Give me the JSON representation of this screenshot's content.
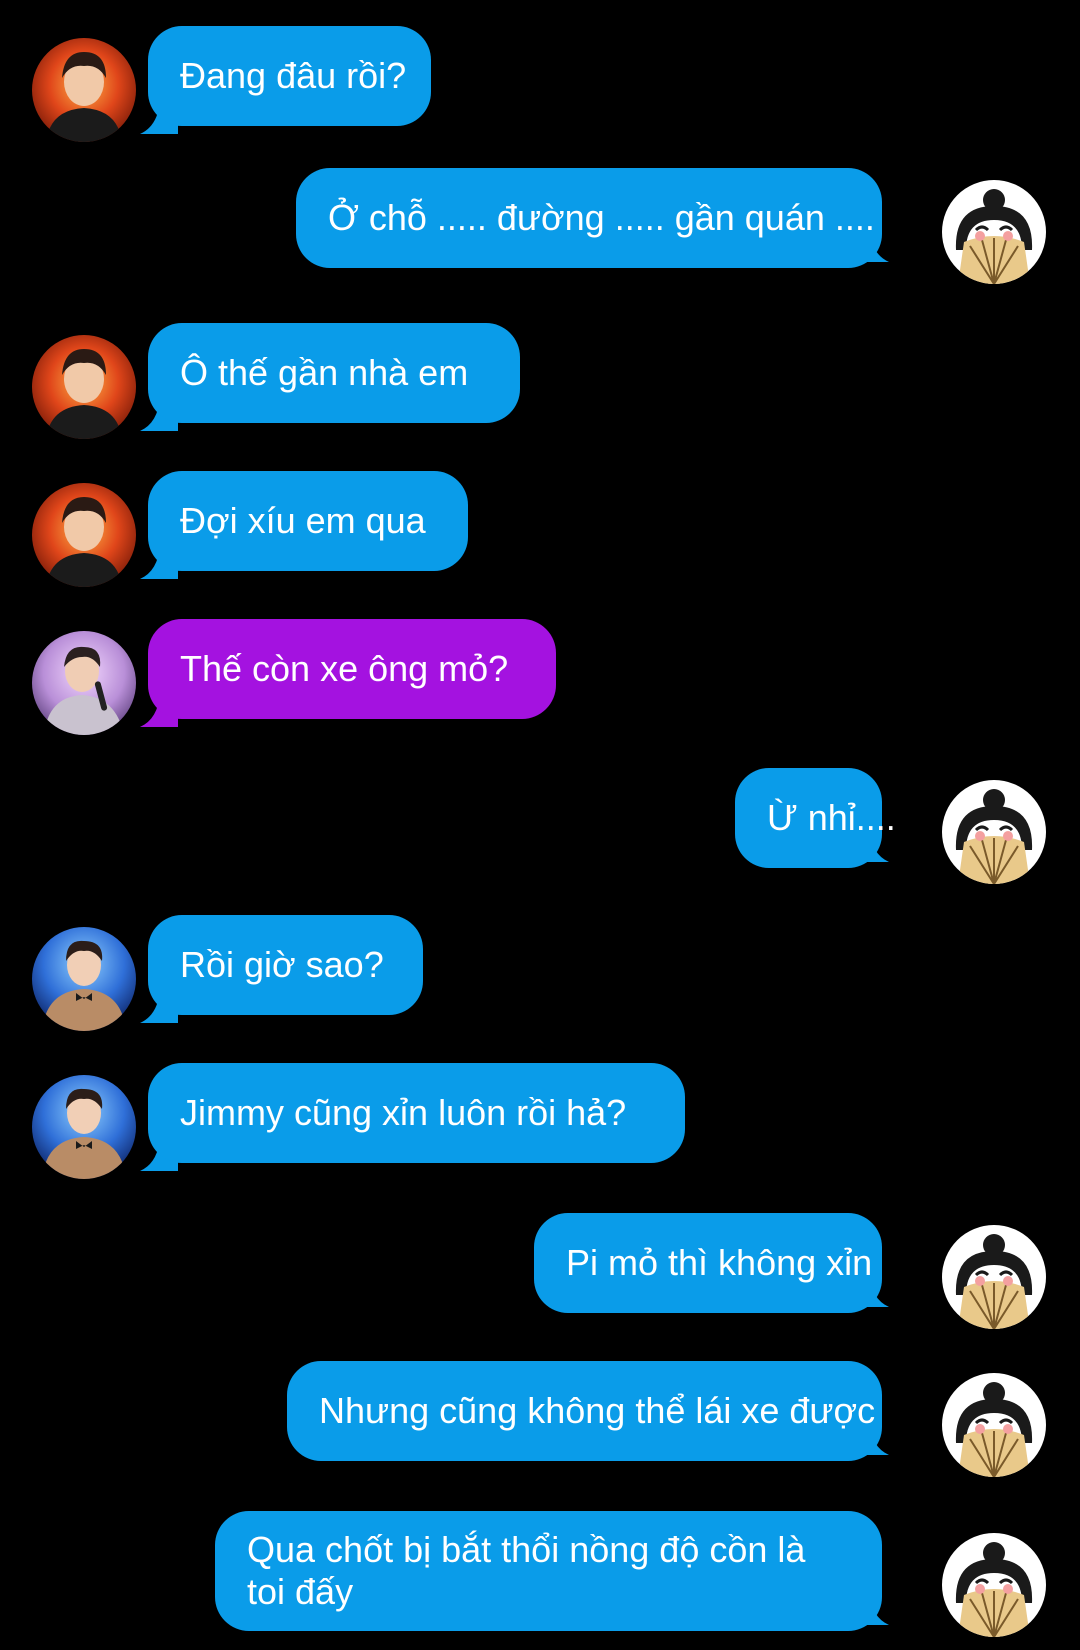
{
  "colors": {
    "background": "#000000",
    "bubble_blue": "#0a9ce9",
    "bubble_purple": "#a412e0",
    "text": "#ffffff"
  },
  "messages": [
    {
      "side": "left",
      "sender": "red-stage-singer",
      "color": "blue",
      "text": "Đang đâu rồi?"
    },
    {
      "side": "right",
      "sender": "me-fan-girl",
      "color": "blue",
      "text": "Ở chỗ ..... đường ..... gần quán ...."
    },
    {
      "side": "left",
      "sender": "red-stage-singer",
      "color": "blue",
      "text": "Ô thế gần nhà em"
    },
    {
      "side": "left",
      "sender": "red-stage-singer",
      "color": "blue",
      "text": "Đợi xíu em qua"
    },
    {
      "side": "left",
      "sender": "mic-singer",
      "color": "purple",
      "text": "Thế còn xe ông mỏ?"
    },
    {
      "side": "right",
      "sender": "me-fan-girl",
      "color": "blue",
      "text": "Ừ nhỉ...."
    },
    {
      "side": "left",
      "sender": "blue-suit-singer",
      "color": "blue",
      "text": "Rồi giờ sao?"
    },
    {
      "side": "left",
      "sender": "blue-suit-singer",
      "color": "blue",
      "text": "Jimmy cũng xỉn luôn rồi hả?"
    },
    {
      "side": "right",
      "sender": "me-fan-girl",
      "color": "blue",
      "text": "Pi mỏ thì không xỉn"
    },
    {
      "side": "right",
      "sender": "me-fan-girl",
      "color": "blue",
      "text": "Nhưng cũng không thể lái xe được"
    },
    {
      "side": "right",
      "sender": "me-fan-girl",
      "color": "blue",
      "text": "Qua chốt bị bắt thổi nồng độ cồn là toi đấy"
    }
  ]
}
